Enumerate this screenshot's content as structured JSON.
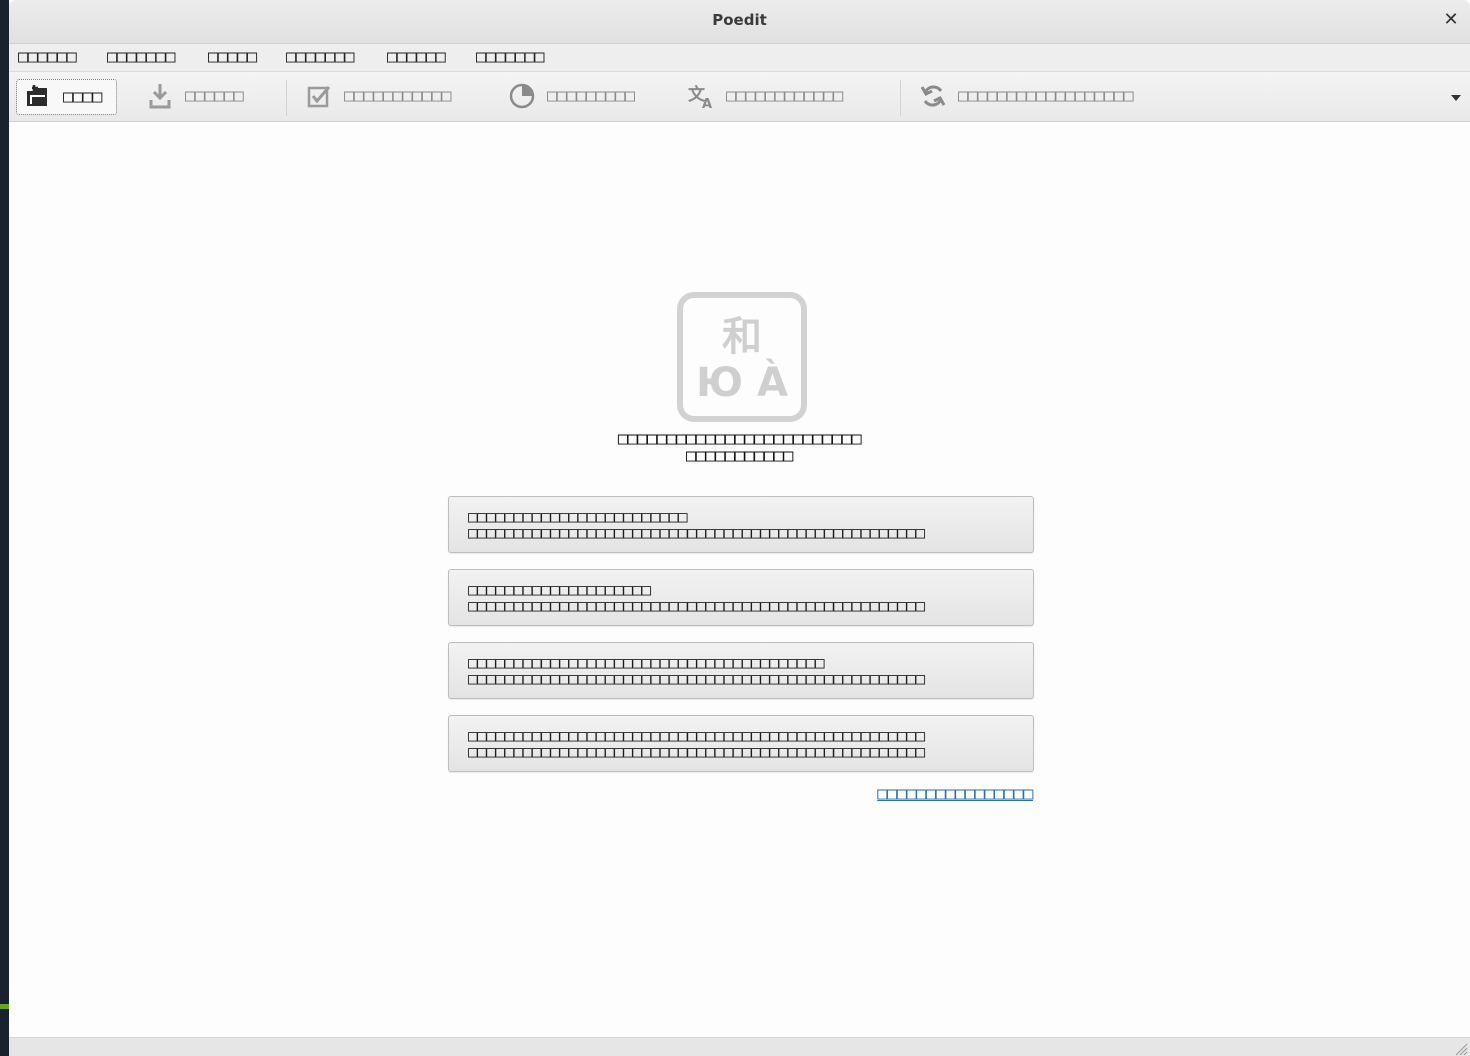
{
  "window": {
    "title": "Poedit"
  },
  "menubar": {
    "items": [
      {
        "name": "menu-file",
        "label": "□□□□□□"
      },
      {
        "name": "menu-edit",
        "label": "□□□□□□□"
      },
      {
        "name": "menu-view",
        "label": "□□□□□"
      },
      {
        "name": "menu-translation",
        "label": "□□□□□□□"
      },
      {
        "name": "menu-catalog",
        "label": "□□□□□□"
      },
      {
        "name": "menu-help",
        "label": "□□□□□□□"
      }
    ]
  },
  "toolbar": {
    "open_label": "□□□□",
    "save_label": "□□□□□□",
    "validate_label": "□□□□□□□□□□□",
    "statistics_label": "□□□□□□□□□",
    "pretranslate_label": "□□□□□□□□□□□□",
    "update_label": "□□□□□□□□□□□□□□□□□□"
  },
  "welcome": {
    "logo_chars": {
      "top": "和",
      "bottom": "Ю À"
    },
    "message_line1": "□□□□□□□□□□□□□□□□□□□□□□□□□",
    "message_line2": "□□□□□□□□□□□",
    "actions": [
      {
        "line1": "□□□□□□□□□□□□□□□□□□□□□□□□",
        "line2": "□□□□□□□□□□□□□□□□□□□□□□□□□□□□□□□□□□□□□□□□□□□□□□□□□□"
      },
      {
        "line1": "□□□□□□□□□□□□□□□□□□□□",
        "line2": "□□□□□□□□□□□□□□□□□□□□□□□□□□□□□□□□□□□□□□□□□□□□□□□□□□"
      },
      {
        "line1": "□□□□□□□□□□□□□□□□□□□□□□□□□□□□□□□□□□□□□□□",
        "line2": "□□□□□□□□□□□□□□□□□□□□□□□□□□□□□□□□□□□□□□□□□□□□□□□□□□"
      },
      {
        "line1": "□□□□□□□□□□□□□□□□□□□□□□□□□□□□□□□□□□□□□□□□□□□□□□□□□□",
        "line2": "□□□□□□□□□□□□□□□□□□□□□□□□□□□□□□□□□□□□□□□□□□□□□□□□□□"
      }
    ],
    "link_label": "□□□□□□□□□□□□□□□□"
  },
  "colors": {
    "link": "#2a6fb0",
    "toolbar_disabled_text": "#8a8a8a",
    "desktop_accent": "#6aa326"
  }
}
